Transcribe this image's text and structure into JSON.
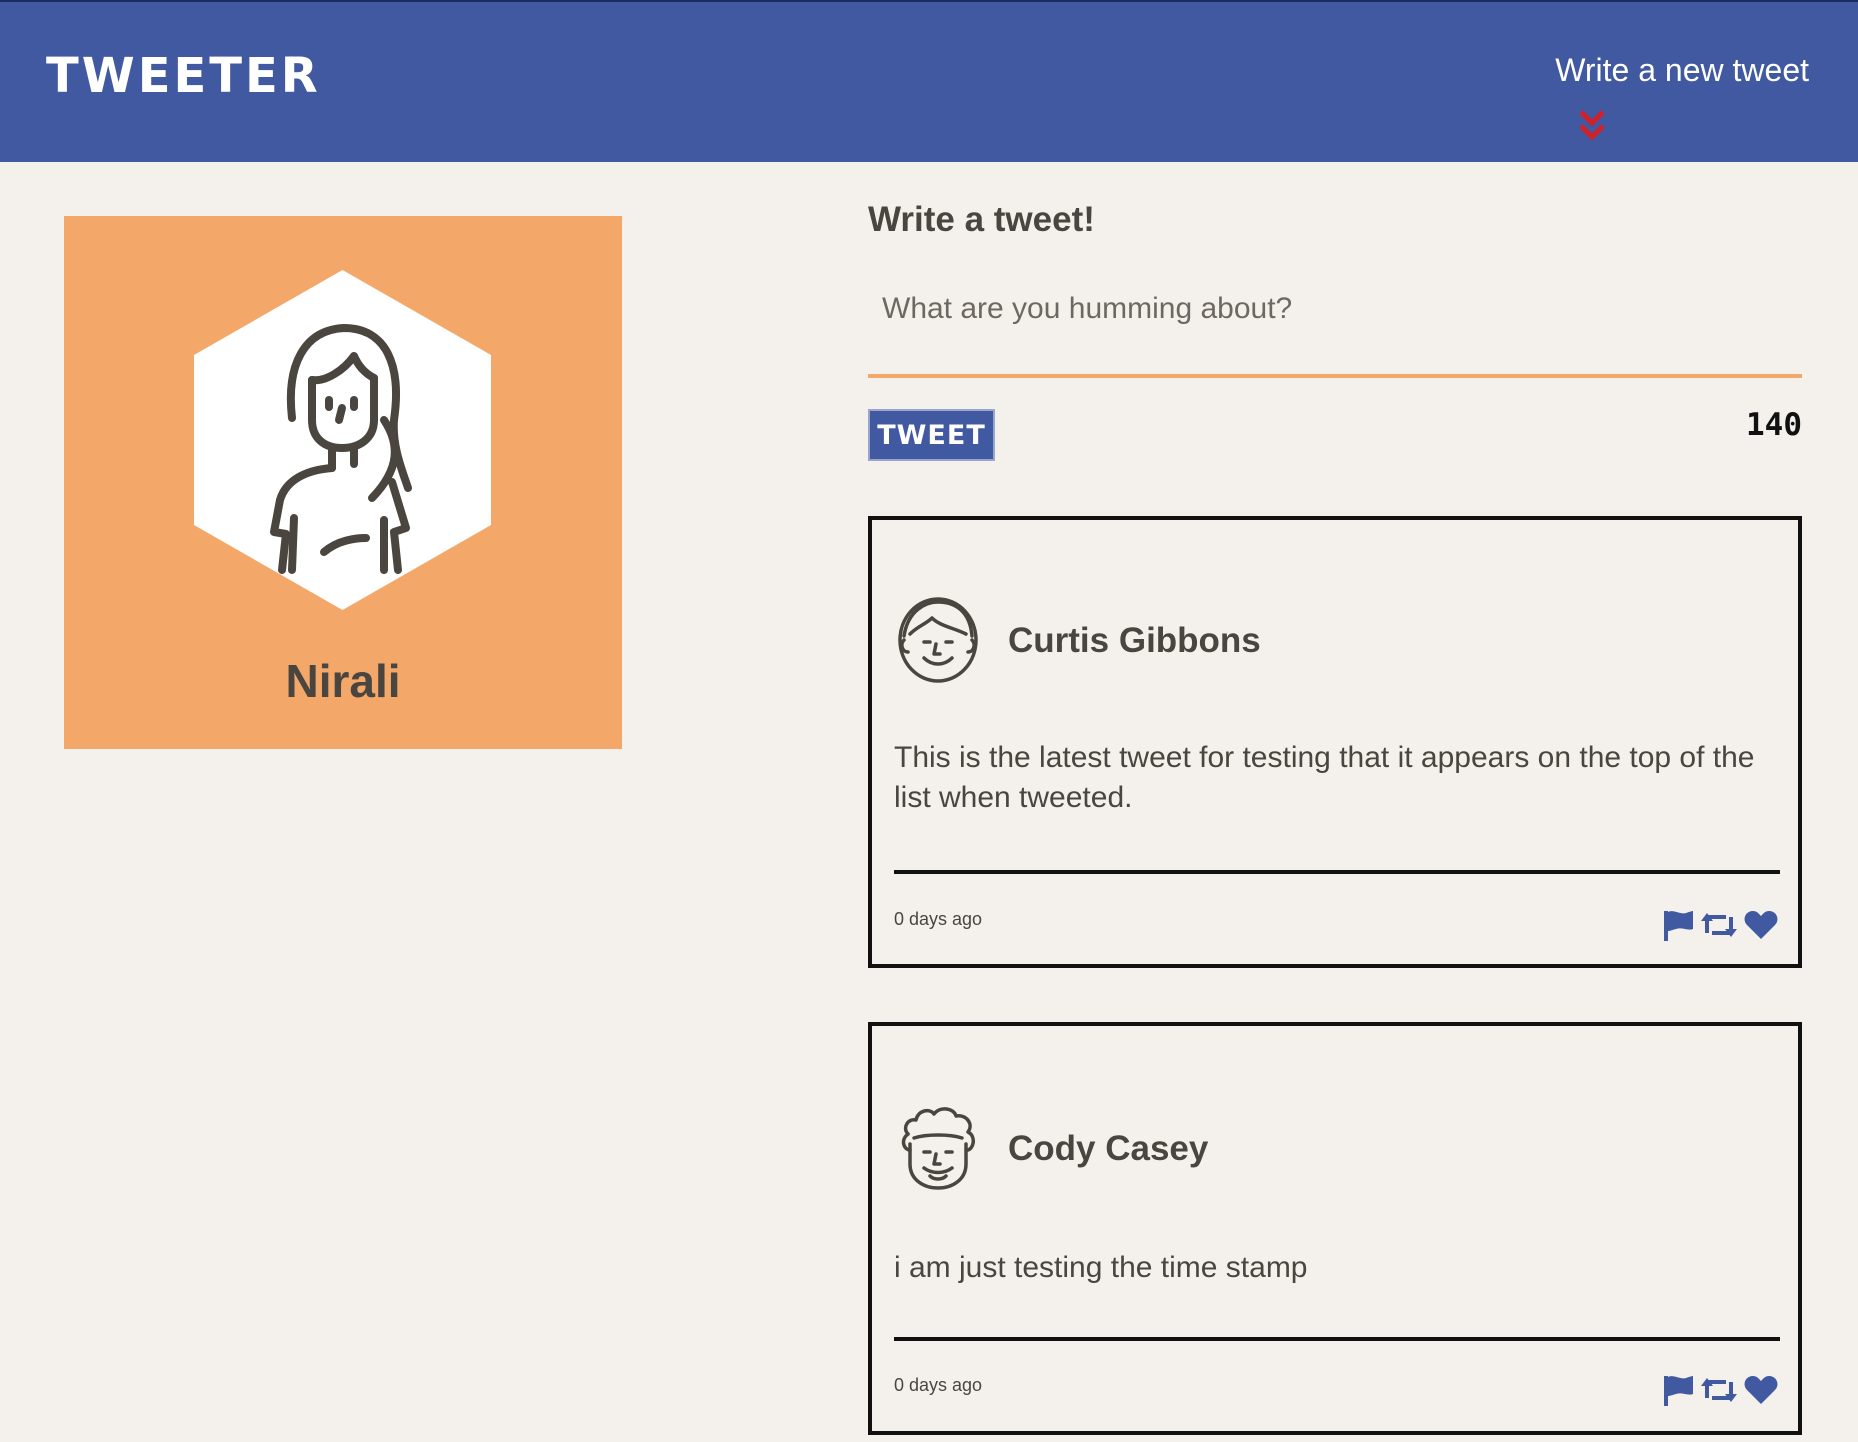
{
  "header": {
    "brand": "TWEETER",
    "compose_toggle_label": "Write a new tweet",
    "compose_toggle_icon": "double-chevron-down-icon"
  },
  "profile": {
    "name": "Nirali",
    "avatar_icon": "woman-avatar-icon"
  },
  "composer": {
    "title": "Write a tweet!",
    "placeholder": "What are you humming about?",
    "button_label": "TWEET",
    "char_count": "140"
  },
  "tweets": [
    {
      "author": "Curtis Gibbons",
      "avatar_icon": "man-avatar-icon",
      "body": "This is the latest tweet for testing that it appears on the top of the list when tweeted.",
      "time": "0 days ago"
    },
    {
      "author": "Cody Casey",
      "avatar_icon": "curly-hair-man-avatar-icon",
      "body": "i am just testing the time stamp",
      "time": "0 days ago"
    }
  ],
  "colors": {
    "nav": "#4159a0",
    "accent": "#f3a86a",
    "page_bg": "#f4f1ec",
    "text": "#4a453f",
    "chevron": "#d0202a"
  }
}
